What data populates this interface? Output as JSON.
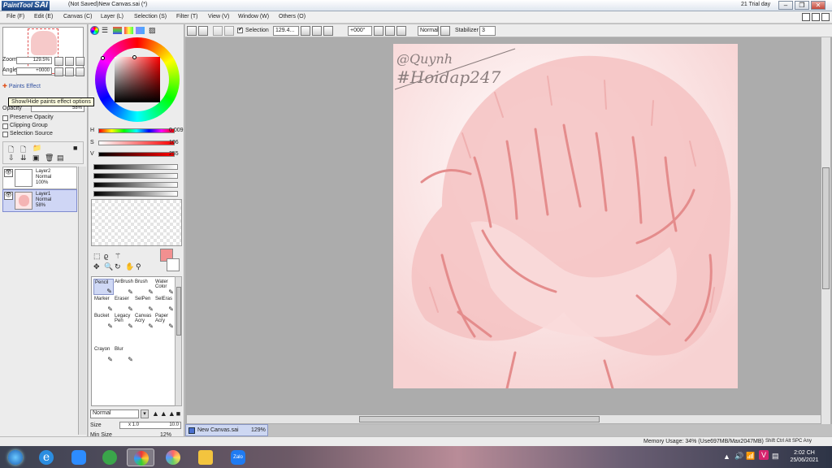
{
  "titlebar": {
    "app_name": "PaintTool",
    "app_short": "SAI",
    "document": "(Not Saved)New Canvas.sai (*)",
    "trial": "21 Trial day"
  },
  "menu": [
    "File (F)",
    "Edit (E)",
    "Canvas (C)",
    "Layer (L)",
    "Selection (S)",
    "Filter (T)",
    "View (V)",
    "Window (W)",
    "Others (O)"
  ],
  "navigator": {
    "zoom_label": "Zoom",
    "zoom_value": "129.5%",
    "angle_label": "Angle",
    "angle_value": "+0000"
  },
  "layer_panel": {
    "paints_effect": "Paints Effect",
    "tooltip": "Show/Hide paints effect options",
    "opacity_label": "Opacity",
    "opacity_value": "58%",
    "preserve_opacity": "Preserve Opacity",
    "clipping_group": "Clipping Group",
    "selection_source": "Selection Source",
    "layers": [
      {
        "name": "Layer2",
        "mode": "Normal",
        "opacity": "100%"
      },
      {
        "name": "Layer1",
        "mode": "Normal",
        "opacity": "58%"
      }
    ]
  },
  "color": {
    "h_label": "H",
    "h_value": "0.009",
    "s_label": "S",
    "s_value": "106",
    "v_label": "V",
    "v_value": "255",
    "fg_color": "#f29090",
    "bg_color": "#ffffff"
  },
  "tools": [
    {
      "name": "Pencil",
      "selected": true
    },
    {
      "name": "AirBrush"
    },
    {
      "name": "Brush"
    },
    {
      "name": "Water Color"
    },
    {
      "name": "Marker"
    },
    {
      "name": "Eraser"
    },
    {
      "name": "SelPen"
    },
    {
      "name": "SelEras"
    },
    {
      "name": "Bucket"
    },
    {
      "name": "Legacy Pen"
    },
    {
      "name": "Canvas Acry"
    },
    {
      "name": "Paper Acry"
    },
    {
      "name": "Crayon"
    },
    {
      "name": "Blur"
    }
  ],
  "brush": {
    "blend_mode": "Normal",
    "size_label": "Size",
    "size_mult": "x 1.0",
    "size_value": "10.0",
    "min_size_label": "Min Size",
    "min_size_value": "12%"
  },
  "toolbar": {
    "selection_label": "Selection",
    "zoom_field": "129.4...",
    "angle_field": "+000°",
    "mode": "Normal",
    "stabilizer_label": "Stabilizer",
    "stabilizer_value": "3"
  },
  "canvas": {
    "signature_line1": "@Quynh",
    "signature_line2": "#Hoidap247"
  },
  "doc_tab": {
    "name": "New Canvas.sai",
    "zoom": "129%"
  },
  "status": {
    "memory": "Memory Usage: 34% (Use697MB/Max2047MB)",
    "keys": "Shift Ctrl Alt SPC  Any"
  },
  "taskbar": {
    "time": "2:02 CH",
    "date": "25/06/2021",
    "zalo": "Zalo"
  }
}
